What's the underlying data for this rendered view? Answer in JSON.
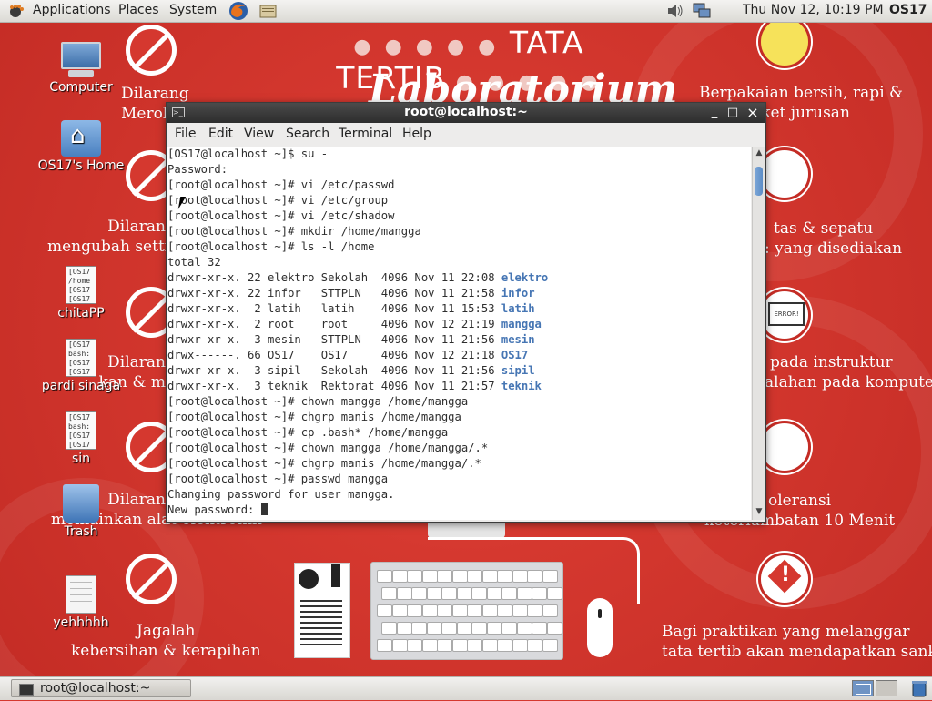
{
  "top_panel": {
    "menus": [
      "Applications",
      "Places",
      "System"
    ],
    "launchers": [
      "firefox-icon",
      "notes-icon"
    ],
    "tray_icons": [
      "volume-icon",
      "network-icon"
    ],
    "clock": "Thu Nov 12, 10:19 PM",
    "hostname": "OS17"
  },
  "wallpaper": {
    "title": "TATA TERTIB",
    "title_dots_left": "● ● ● ● ●",
    "title_dots_right": "● ● ● ● ●",
    "script": "Laboratorium",
    "rules_left": [
      {
        "line1": "Dilarang",
        "line2": "Meroko"
      },
      {
        "line1": "Dilaran",
        "line2": "mengubah setting"
      },
      {
        "line1": "Dilaran",
        "line2": "kan & m"
      },
      {
        "line1": "Dilaran",
        "line2": "memainkan alat elektronik"
      },
      {
        "line1": "Jagalah",
        "line2": "kebersihan & kerapihan"
      }
    ],
    "rules_right": [
      {
        "line1": "Berpakaian bersih, rapi &",
        "line2": "kan jaket jurusan"
      },
      {
        "line1": "tas & sepatu",
        "line2": ": yang disediakan"
      },
      {
        "line1": "pada instruktur",
        "line2": "alahan pada komputer"
      },
      {
        "line1": "oleransi",
        "line2": "keterlambatan 10 Menit"
      },
      {
        "line1": "Bagi praktikan yang melanggar",
        "line2": "tata tertib akan mendapatkan sanksi"
      }
    ],
    "error_label": "ERROR!"
  },
  "desktop_icons": [
    {
      "label": "Computer",
      "icon": "computer-icon"
    },
    {
      "label": "OS17's Home",
      "icon": "home-folder-icon"
    },
    {
      "label": "chitaPP",
      "icon": "text-file-icon",
      "preview": "[OS17\n/home\n[OS17\n[OS17"
    },
    {
      "label": "pardi sinaga",
      "icon": "text-file-icon",
      "preview": "[OS17\nbash:\n[OS17\n[OS17"
    },
    {
      "label": "sin",
      "icon": "text-file-icon",
      "preview": "[OS17\nbash:\n[OS17\n[OS17"
    },
    {
      "label": "Trash",
      "icon": "trash-icon"
    },
    {
      "label": "yehhhhh",
      "icon": "text-file-icon"
    }
  ],
  "terminal": {
    "title": "root@localhost:~",
    "controls": {
      "minimize": "_",
      "maximize": "□",
      "close": "×"
    },
    "menu": [
      "File",
      "Edit",
      "View",
      "Search",
      "Terminal",
      "Help"
    ],
    "lines_before": [
      "[OS17@localhost ~]$ su -",
      "Password:",
      "[root@localhost ~]# vi /etc/passwd",
      "[root@localhost ~]# vi /etc/group",
      "[root@localhost ~]# vi /etc/shadow",
      "[root@localhost ~]# mkdir /home/mangga",
      "[root@localhost ~]# ls -l /home",
      "total 32"
    ],
    "listing": [
      {
        "prefix": "drwxr-xr-x. 22 elektro Sekolah  4096 Nov 11 22:08 ",
        "name": "elektro"
      },
      {
        "prefix": "drwxr-xr-x. 22 infor   STTPLN   4096 Nov 11 21:58 ",
        "name": "infor"
      },
      {
        "prefix": "drwxr-xr-x.  2 latih   latih    4096 Nov 11 15:53 ",
        "name": "latih"
      },
      {
        "prefix": "drwxr-xr-x.  2 root    root     4096 Nov 12 21:19 ",
        "name": "mangga"
      },
      {
        "prefix": "drwxr-xr-x.  3 mesin   STTPLN   4096 Nov 11 21:56 ",
        "name": "mesin"
      },
      {
        "prefix": "drwx------. 66 OS17    OS17     4096 Nov 12 21:18 ",
        "name": "OS17"
      },
      {
        "prefix": "drwxr-xr-x.  3 sipil   Sekolah  4096 Nov 11 21:56 ",
        "name": "sipil"
      },
      {
        "prefix": "drwxr-xr-x.  3 teknik  Rektorat 4096 Nov 11 21:57 ",
        "name": "teknik"
      }
    ],
    "lines_after": [
      "[root@localhost ~]# chown mangga /home/mangga",
      "[root@localhost ~]# chgrp manis /home/mangga",
      "[root@localhost ~]# cp .bash* /home/mangga",
      "[root@localhost ~]# chown mangga /home/mangga/.*",
      "[root@localhost ~]# chgrp manis /home/mangga/.*",
      "[root@localhost ~]# passwd mangga",
      "Changing password for user mangga.",
      "New password: "
    ],
    "dir_color": "#4676b4"
  },
  "bottom_panel": {
    "task_label": "root@localhost:~",
    "workspaces": 2
  }
}
